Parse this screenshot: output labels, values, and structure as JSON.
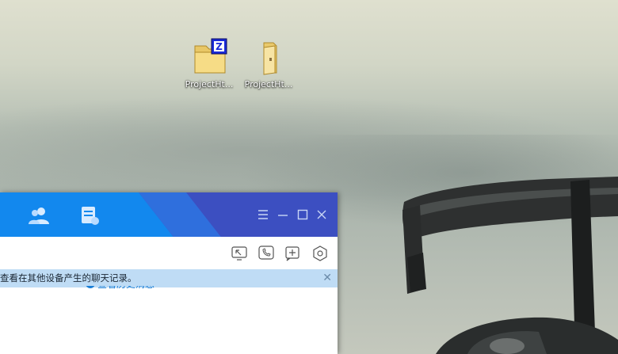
{
  "desktop": {
    "icons": [
      {
        "label": "ProjectHt...",
        "icon": "zip-folder-icon"
      },
      {
        "label": "ProjectHt...",
        "icon": "folder-icon"
      }
    ]
  },
  "chat_window": {
    "tabs": [
      {
        "icon": "contacts-icon"
      },
      {
        "icon": "notes-icon"
      }
    ],
    "window_controls": [
      "menu-icon",
      "minimize-icon",
      "maximize-icon",
      "close-icon"
    ],
    "toolbar_tools": [
      "screen-share-icon",
      "voice-call-icon",
      "add-member-icon",
      "settings-icon"
    ],
    "notice": {
      "text": "查看在其他设备产生的聊天记录。",
      "close": "✕"
    },
    "history_link": "查看历史消息",
    "colors": {
      "titlebar_primary": "#1288ee",
      "titlebar_accent": "#3c4fc1",
      "notice_bg": "#bfdcf5",
      "link": "#1a7ed6"
    }
  }
}
